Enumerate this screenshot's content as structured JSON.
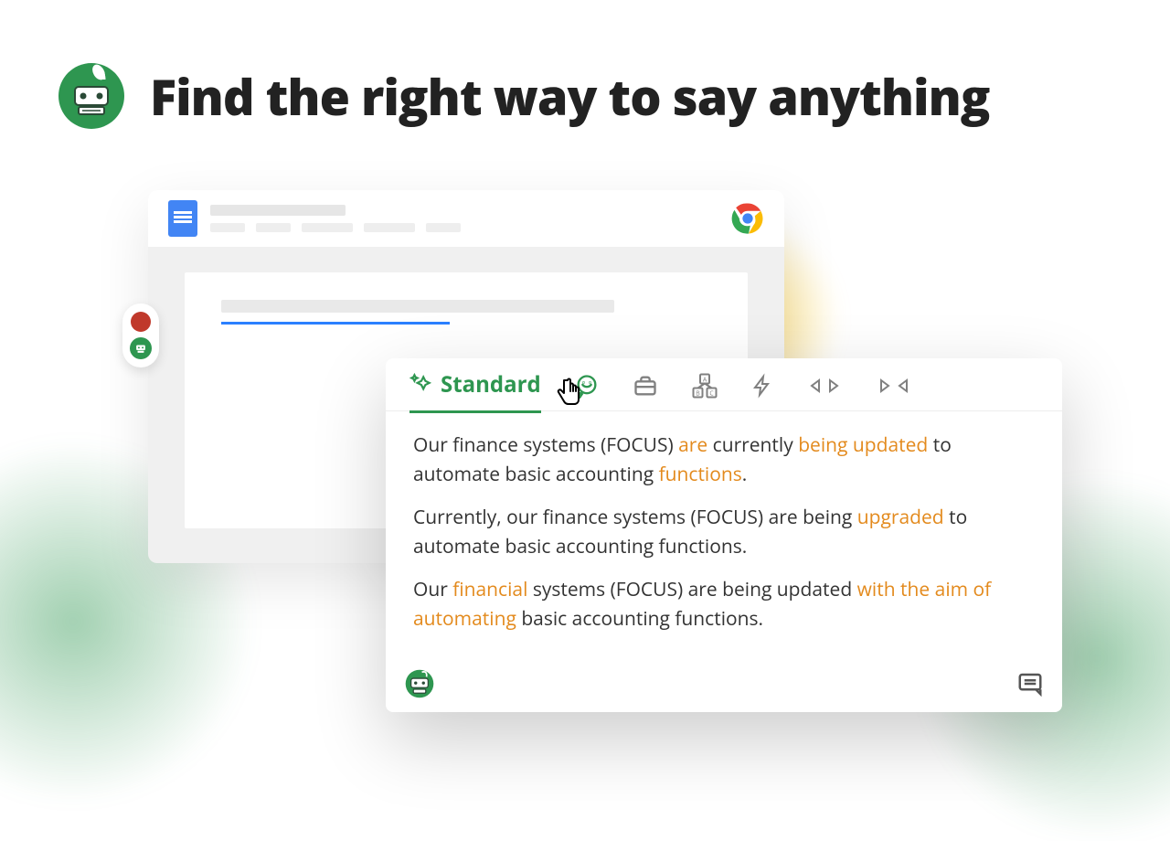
{
  "header": {
    "title": "Find the right way to say anything"
  },
  "colors": {
    "accent_green": "#2e9650",
    "highlight_orange": "#e38a1d",
    "link_blue": "#2b80ff"
  },
  "overlay": {
    "tabs": {
      "standard": {
        "label": "Standard",
        "icon": "sparkle-star-icon",
        "active": true
      },
      "icons": [
        "chat-bubble-icon",
        "briefcase-icon",
        "abc-boxes-icon",
        "lightning-icon",
        "expand-arrows-icon",
        "contract-arrows-icon"
      ]
    },
    "suggestions": [
      {
        "tokens": [
          {
            "t": "Our finance systems (FOCUS) "
          },
          {
            "t": "are",
            "hl": true
          },
          {
            "t": " currently "
          },
          {
            "t": "being updated",
            "hl": true
          },
          {
            "t": " to automate basic accounting "
          },
          {
            "t": "functions",
            "hl": true
          },
          {
            "t": "."
          }
        ]
      },
      {
        "tokens": [
          {
            "t": "Currently, our finance systems (FOCUS) are being "
          },
          {
            "t": "upgraded",
            "hl": true
          },
          {
            "t": " to automate basic accounting functions."
          }
        ]
      },
      {
        "tokens": [
          {
            "t": "Our "
          },
          {
            "t": "financial",
            "hl": true
          },
          {
            "t": " systems (FOCUS) are being updated "
          },
          {
            "t": "with the aim of",
            "hl": true
          },
          {
            "t": " "
          },
          {
            "t": "automating",
            "hl": true
          },
          {
            "t": " basic accounting functions."
          }
        ]
      }
    ]
  }
}
